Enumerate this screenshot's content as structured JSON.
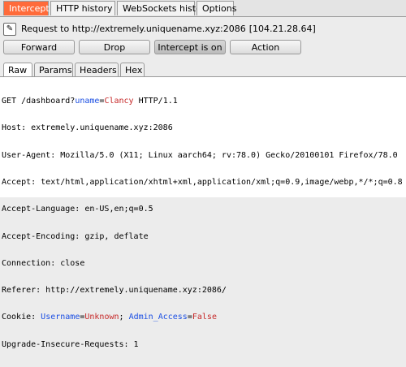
{
  "tabs": [
    {
      "label": "Intercept",
      "active": true
    },
    {
      "label": "HTTP history",
      "active": false
    },
    {
      "label": "WebSockets history",
      "active": false
    },
    {
      "label": "Options",
      "active": false
    }
  ],
  "request_target": {
    "prefix": "Request to ",
    "url": "http://extremely.uniquename.xyz:2086",
    "ip": "[104.21.28.64]"
  },
  "buttons": {
    "forward": "Forward",
    "drop": "Drop",
    "intercept": "Intercept is on",
    "action": "Action"
  },
  "subtabs": [
    "Raw",
    "Params",
    "Headers",
    "Hex"
  ],
  "request": {
    "request_line": {
      "pre": "GET /dashboard?",
      "param_name": "uname",
      "eq": "=",
      "param_value": "Clancy",
      "post": " HTTP/1.1"
    },
    "host": "Host: extremely.uniquename.xyz:2086",
    "user_agent": "User-Agent: Mozilla/5.0 (X11; Linux aarch64; rv:78.0) Gecko/20100101 Firefox/78.0",
    "accept": "Accept: text/html,application/xhtml+xml,application/xml;q=0.9,image/webp,*/*;q=0.8",
    "accept_language": "Accept-Language: en-US,en;q=0.5",
    "accept_encoding": "Accept-Encoding: gzip, deflate",
    "connection": "Connection: close",
    "referer": "Referer: http://extremely.uniquename.xyz:2086/",
    "cookie": {
      "pre": "Cookie: ",
      "c1_name": "Username",
      "c1_eq": "=",
      "c1_value": "Unknown",
      "sep": "; ",
      "c2_name": "Admin_Access",
      "c2_eq": "=",
      "c2_value": "False"
    },
    "upgrade": "Upgrade-Insecure-Requests: 1"
  },
  "colors": {
    "active_tab": "#ff6b3a",
    "param_name": "#1a4ee3",
    "param_value": "#c62828"
  }
}
